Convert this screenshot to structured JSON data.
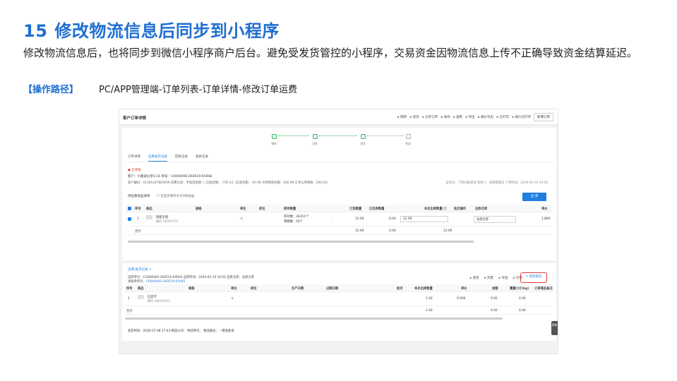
{
  "slide": {
    "number": "15",
    "title": "修改物流信息后同步到小程序",
    "description": "修改物流信息后，也将同步到微信小程序商户后台。避免受发货管控的小程序，交易资金因物流信息上传不正确导致资金结算延迟。",
    "path_tag": "【操作路径】",
    "path": "PC/APP管理端-订单列表-订单详情-修改订单运费"
  },
  "screenshot": {
    "page_title": "客户订单详情",
    "toolbar": [
      "刷新",
      "退货",
      "分享订单",
      "关闭",
      "复制",
      "导出",
      "报价导出",
      "已打印",
      "报价已打印"
    ],
    "new_button": "新增订单",
    "steps": [
      {
        "label": "审核",
        "done": true
      },
      {
        "label": "出库",
        "done": true
      },
      {
        "label": "发货",
        "done": true
      },
      {
        "label": "完成",
        "done": false
      }
    ],
    "tabs": [
      "订单详情",
      "出库发货记录",
      "回款记录",
      "收款记录"
    ],
    "active_tab": 1,
    "status": "已审核",
    "customer_line": "客户：小鹿试分享1.16    单号：CA000000-260519-91948",
    "detail_line": "客户编码：01181207863656    结算方式：不固定账期 ⓘ    应收金额：-759.54（应收金额：-63.96   可用预收金额：466.98   订单占用预收：206.62）",
    "detail_right": "业务员：丁特分账测试    制单人：系统管理员    下单时间：2026-05-19 16:56",
    "list_title": "待出库商品清单",
    "list_option": "仅显示库存大于0的商品",
    "outbound_button": "出 库",
    "table1": {
      "headers": [
        "序号",
        "商品",
        "规格",
        "单位",
        "库位",
        "库存数量",
        "订货数量",
        "已出库数量",
        "本次出库数量 ⓘ",
        "批次操作",
        "出库仓库",
        "单价"
      ],
      "row": {
        "index": "1",
        "product": "智能无阻",
        "code": "编码 98006701",
        "unit": "个",
        "stock1": "库存数：34351个",
        "stock2": "预期数：20个",
        "order_qty": "12.00",
        "out_qty": "0.00",
        "this_qty": "12.00",
        "warehouse": "总部仓库",
        "price": "1.800"
      },
      "total_label": "合计",
      "total_order": "12.00",
      "total_out": "0.00",
      "total_this": "12.00"
    },
    "section2_title": "出库/发货记录 ∧",
    "out_line1": "出库单号：CO000000-260519-94904    出库时间：2026-05-19 16:56    出库仓库：总部仓库",
    "out_line2_label": "关联单单号：",
    "out_line2_link": "CR000000-260519-03005",
    "toolbar2": [
      "退货",
      "作废",
      "导出",
      "打印"
    ],
    "edit_button": "修改物流",
    "table2": {
      "headers": [
        "序号",
        "商品",
        "规格",
        "单位",
        "库位",
        "生产日期",
        "过期日期",
        "批次",
        "本次出库数量",
        "单价",
        "金额",
        "重量小计(kg)",
        "订单商品备注"
      ],
      "row": {
        "index": "1",
        "product": "信息学",
        "code": "编码 98006601",
        "unit": "个",
        "qty": "1.00",
        "price": "9.000",
        "amount": "9.00",
        "weight": "0.00"
      },
      "total_label": "合计",
      "total_qty": "1.00",
      "total_amount": "9.00",
      "total_weight": "0.00"
    },
    "ship_line": "发货时间：2026-07-08 17:43    物流公司：    物流单号：    物流备注：    › 物流查询",
    "side_tab": "帮助"
  }
}
